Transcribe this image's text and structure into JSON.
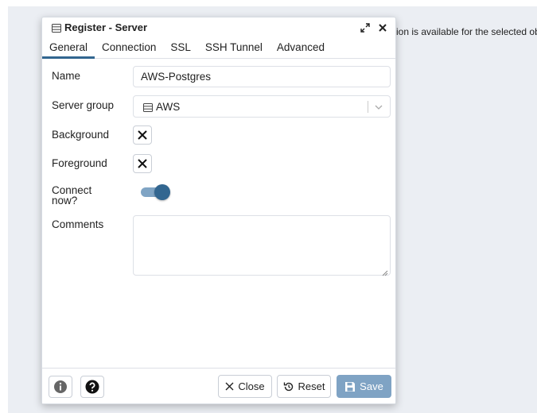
{
  "background": {
    "message": "ion is available for the selected obj"
  },
  "dialog": {
    "title": "Register - Server",
    "tabs": [
      {
        "label": "General",
        "active": true
      },
      {
        "label": "Connection",
        "active": false
      },
      {
        "label": "SSL",
        "active": false
      },
      {
        "label": "SSH Tunnel",
        "active": false
      },
      {
        "label": "Advanced",
        "active": false
      }
    ],
    "fields": {
      "name": {
        "label": "Name",
        "value": "AWS-Postgres"
      },
      "server_group": {
        "label": "Server group",
        "value": "AWS",
        "icon": "server-group-icon"
      },
      "background": {
        "label": "Background",
        "icon": "x-icon"
      },
      "foreground": {
        "label": "Foreground",
        "icon": "x-icon"
      },
      "connect_now": {
        "label_line1": "Connect",
        "label_line2": "now?",
        "on": true
      },
      "comments": {
        "label": "Comments",
        "value": ""
      }
    },
    "footer": {
      "info_icon": "info-icon",
      "help_icon": "help-icon",
      "close_label": "Close",
      "reset_label": "Reset",
      "save_label": "Save"
    }
  },
  "colors": {
    "accent": "#326690",
    "save_button": "#7fa3c4",
    "backdrop": "#ebeef3"
  }
}
